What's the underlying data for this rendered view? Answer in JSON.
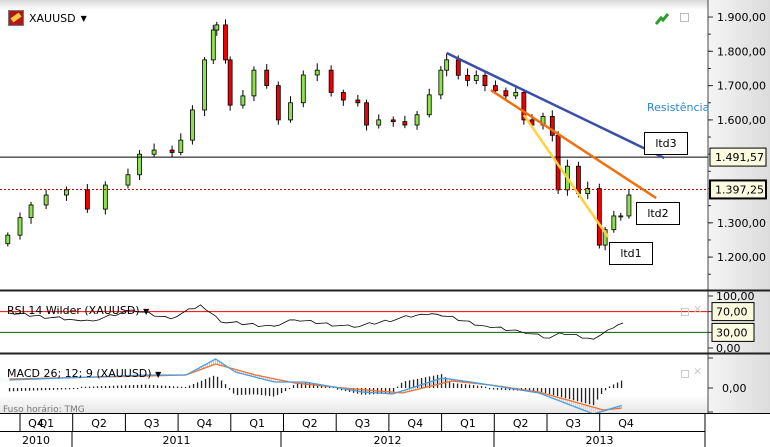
{
  "instrument": {
    "symbol": "XAUUSD"
  },
  "price_panel": {
    "axis_labels": [
      "1.900,00",
      "1.800,00",
      "1.700,00",
      "1.600,00",
      "1.300,00",
      "1.200,00"
    ],
    "axis_values": [
      1900,
      1800,
      1700,
      1600,
      1300,
      1200
    ],
    "hlines": [
      {
        "value": 1491.57,
        "label": "1.491,57",
        "color": "#000000",
        "style": "solid"
      },
      {
        "value": 1397.25,
        "label": "1.397,25",
        "color": "#cc0000",
        "style": "dotted"
      }
    ],
    "resistance_label": "Resistência",
    "trendlines": [
      {
        "name": "ltd3",
        "color": "#3a4fa8",
        "from": [
          "2012-10-05",
          1795
        ],
        "to": [
          "2013-10-15",
          1489
        ]
      },
      {
        "name": "ltd2",
        "color": "#f07010",
        "from": [
          "2012-12-20",
          1687
        ],
        "to": [
          "2013-10-01",
          1372
        ]
      },
      {
        "name": "ltd1",
        "color": "#ffd040",
        "from": [
          "2013-02-15",
          1614
        ],
        "to": [
          "2013-07-10",
          1259
        ]
      }
    ],
    "labels": [
      "ltd3",
      "ltd2",
      "ltd1"
    ]
  },
  "rsi_panel": {
    "title": "RSI 14 Wilder (XAUUSD)",
    "axis_labels": [
      "100,00",
      "70,00",
      "30,00",
      "0,00"
    ],
    "overbought": 70,
    "oversold": 30,
    "colors": {
      "line": "#000000",
      "overbought": "#ff0000",
      "oversold": "#006600"
    }
  },
  "macd_panel": {
    "title": "MACD 26; 12; 9 (XAUUSD)",
    "axis_label_zero": "0,00",
    "colors": {
      "macd": "#4a9ee0",
      "signal": "#f07030"
    }
  },
  "footer": {
    "timezone": "Fuso horário: TMG"
  },
  "x_axis": {
    "quarters": [
      "Q4",
      "Q1",
      "Q2",
      "Q3",
      "Q4",
      "Q1",
      "Q2",
      "Q3",
      "Q4",
      "Q1",
      "Q2",
      "Q3",
      "Q4"
    ],
    "years": [
      "2010",
      "2011",
      "2012",
      "2013"
    ]
  },
  "chart_data": [
    {
      "type": "candlestick",
      "series_name": "XAUUSD",
      "ylim": [
        1150,
        1950
      ],
      "up_color": "#8ee050",
      "down_color": "#ee0000",
      "closes": [
        [
          "2010-09-10",
          1264
        ],
        [
          "2010-10-01",
          1315
        ],
        [
          "2010-10-20",
          1352
        ],
        [
          "2010-11-15",
          1381
        ],
        [
          "2010-12-20",
          1396
        ],
        [
          "2011-01-25",
          1340
        ],
        [
          "2011-02-25",
          1410
        ],
        [
          "2011-04-05",
          1440
        ],
        [
          "2011-04-25",
          1500
        ],
        [
          "2011-05-20",
          1512
        ],
        [
          "2011-06-20",
          1505
        ],
        [
          "2011-07-05",
          1541
        ],
        [
          "2011-07-25",
          1629
        ],
        [
          "2011-08-15",
          1775
        ],
        [
          "2011-08-30",
          1862
        ],
        [
          "2011-09-05",
          1877
        ],
        [
          "2011-09-20",
          1775
        ],
        [
          "2011-09-28",
          1643
        ],
        [
          "2011-10-20",
          1670
        ],
        [
          "2011-11-08",
          1745
        ],
        [
          "2011-11-30",
          1700
        ],
        [
          "2011-12-20",
          1600
        ],
        [
          "2012-01-10",
          1650
        ],
        [
          "2012-02-01",
          1731
        ],
        [
          "2012-02-25",
          1745
        ],
        [
          "2012-03-20",
          1680
        ],
        [
          "2012-04-10",
          1658
        ],
        [
          "2012-05-05",
          1650
        ],
        [
          "2012-05-20",
          1585
        ],
        [
          "2012-06-10",
          1600
        ],
        [
          "2012-07-05",
          1595
        ],
        [
          "2012-07-25",
          1585
        ],
        [
          "2012-08-15",
          1615
        ],
        [
          "2012-09-05",
          1673
        ],
        [
          "2012-09-25",
          1745
        ],
        [
          "2012-10-05",
          1775
        ],
        [
          "2012-10-25",
          1730
        ],
        [
          "2012-11-10",
          1715
        ],
        [
          "2012-11-25",
          1730
        ],
        [
          "2012-12-10",
          1700
        ],
        [
          "2012-12-28",
          1685
        ],
        [
          "2013-01-15",
          1670
        ],
        [
          "2013-02-01",
          1680
        ],
        [
          "2013-02-15",
          1600
        ],
        [
          "2013-03-01",
          1585
        ],
        [
          "2013-03-20",
          1610
        ],
        [
          "2013-04-05",
          1555
        ],
        [
          "2013-04-15",
          1396
        ],
        [
          "2013-05-01",
          1465
        ],
        [
          "2013-05-20",
          1385
        ],
        [
          "2013-06-05",
          1400
        ],
        [
          "2013-06-25",
          1235
        ],
        [
          "2013-07-05",
          1280
        ],
        [
          "2013-07-20",
          1320
        ],
        [
          "2013-08-01",
          1320
        ],
        [
          "2013-08-15",
          1381
        ]
      ]
    },
    {
      "type": "line",
      "series_name": "RSI 14 Wilder",
      "ylim": [
        0,
        100
      ],
      "points": [
        [
          "2010-09-13",
          67
        ],
        [
          "2011-01-03",
          54
        ],
        [
          "2011-02-04",
          52
        ],
        [
          "2011-04-12",
          73
        ],
        [
          "2011-06-18",
          56
        ],
        [
          "2011-08-08",
          83
        ],
        [
          "2011-09-12",
          50
        ],
        [
          "2011-12-13",
          42
        ],
        [
          "2012-01-17",
          54
        ],
        [
          "2012-04-28",
          40
        ],
        [
          "2012-08-23",
          65
        ],
        [
          "2012-09-18",
          65
        ],
        [
          "2012-12-11",
          42
        ],
        [
          "2013-02-10",
          31
        ],
        [
          "2013-03-31",
          19
        ],
        [
          "2013-04-17",
          29
        ],
        [
          "2013-06-15",
          17
        ],
        [
          "2013-07-10",
          35
        ],
        [
          "2013-08-05",
          48
        ]
      ]
    },
    {
      "type": "line",
      "series_name": "MACD 26; 12; 9",
      "macd": [
        [
          "2010-09-13",
          16
        ],
        [
          "2011-05-06",
          26
        ],
        [
          "2011-07-14",
          26
        ],
        [
          "2011-09-03",
          58
        ],
        [
          "2011-10-07",
          32
        ],
        [
          "2011-12-13",
          12
        ],
        [
          "2012-02-04",
          12
        ],
        [
          "2012-05-13",
          -8
        ],
        [
          "2012-07-04",
          -12
        ],
        [
          "2012-09-27",
          20
        ],
        [
          "2012-11-16",
          12
        ],
        [
          "2013-03-13",
          -10
        ],
        [
          "2013-06-15",
          -52
        ],
        [
          "2013-08-05",
          -34
        ]
      ],
      "signal": [
        [
          "2010-09-13",
          18
        ],
        [
          "2011-05-06",
          24
        ],
        [
          "2011-07-14",
          26
        ],
        [
          "2011-09-03",
          48
        ],
        [
          "2011-11-11",
          26
        ],
        [
          "2012-01-17",
          10
        ],
        [
          "2012-04-10",
          0
        ],
        [
          "2012-07-21",
          -10
        ],
        [
          "2012-10-14",
          14
        ],
        [
          "2012-12-20",
          6
        ],
        [
          "2013-03-13",
          -8
        ],
        [
          "2013-07-02",
          -44
        ],
        [
          "2013-08-05",
          -40
        ]
      ]
    }
  ]
}
